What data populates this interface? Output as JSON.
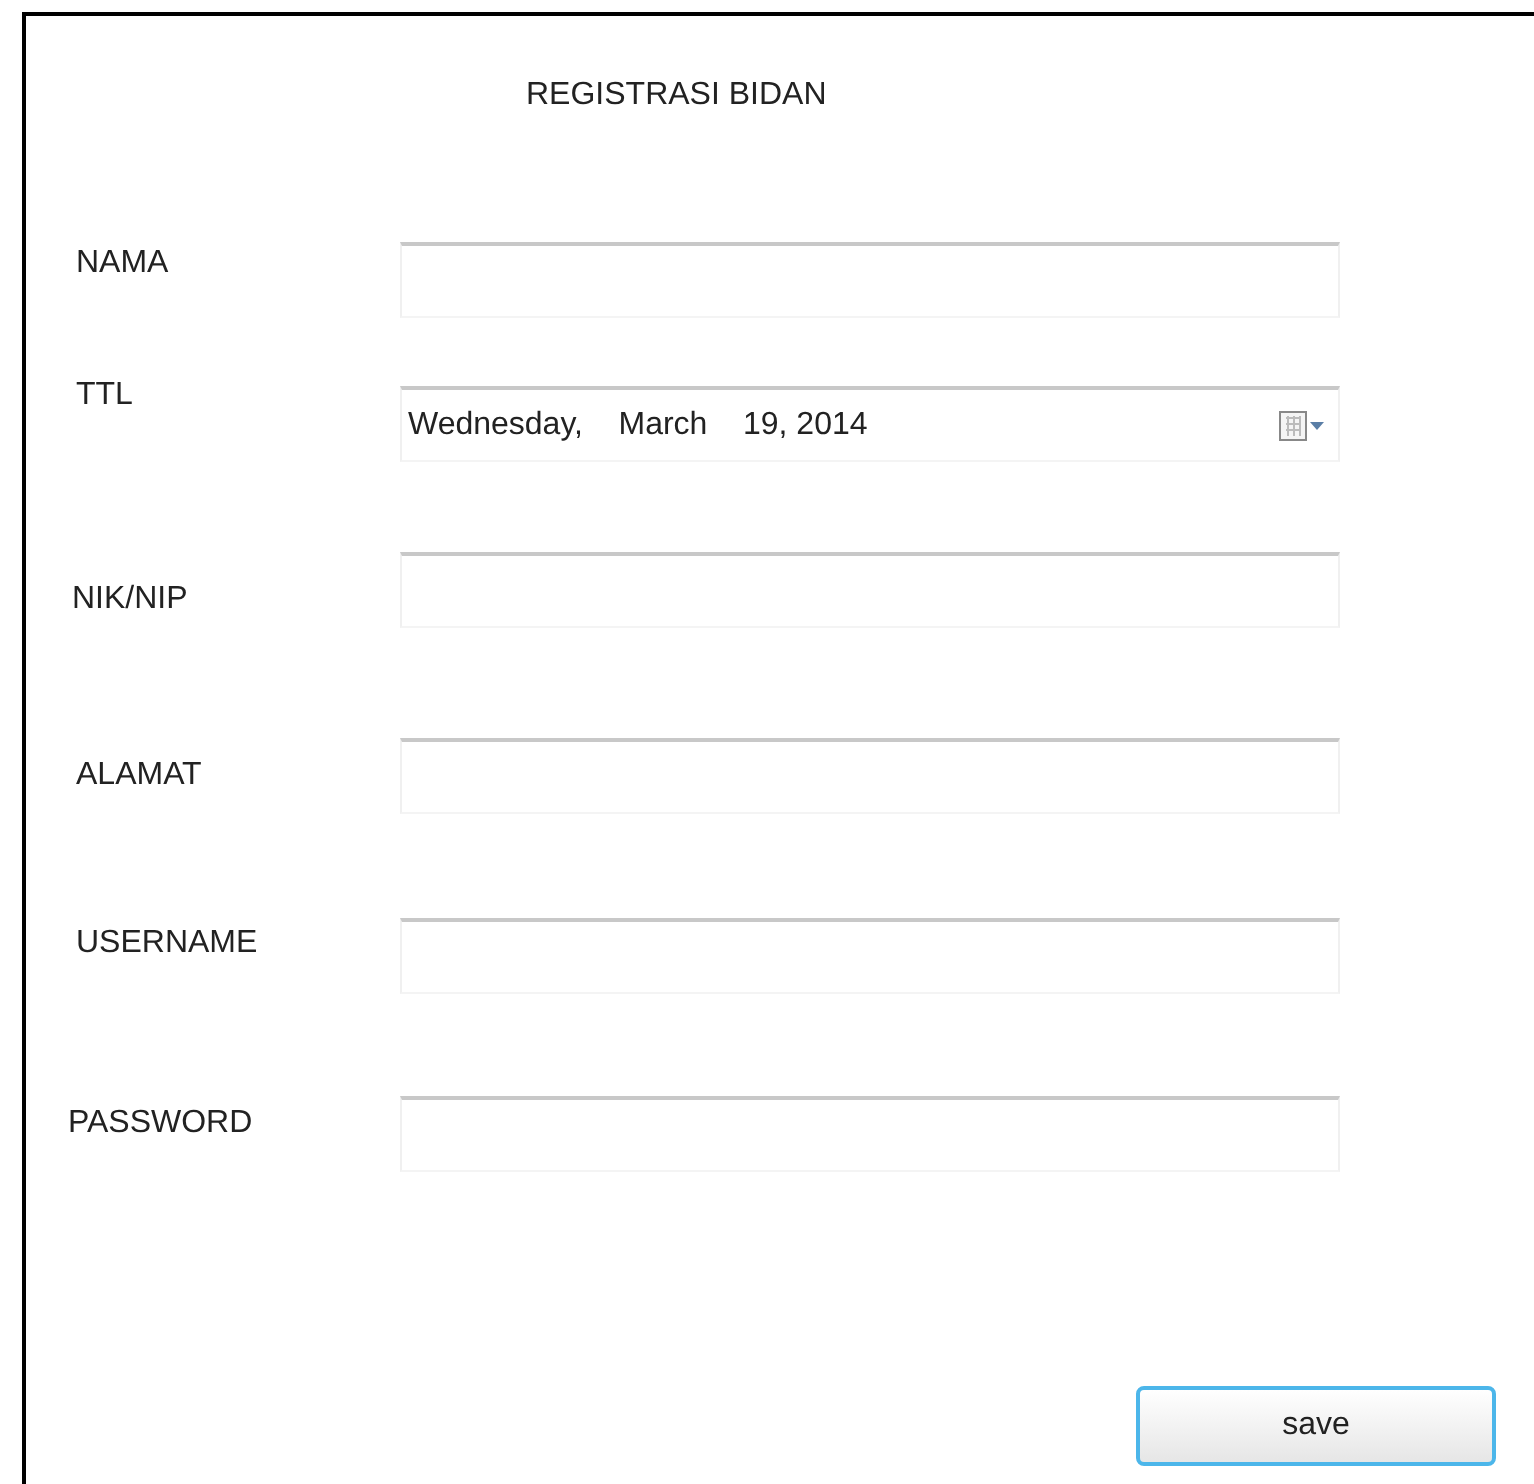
{
  "title": "REGISTRASI BIDAN",
  "fields": [
    {
      "label": "NAMA",
      "kind": "text"
    },
    {
      "label": "TTL",
      "kind": "date",
      "value": "Wednesday,    March    19, 2014"
    },
    {
      "label": "NIK/NIP",
      "kind": "text"
    },
    {
      "label": "ALAMAT",
      "kind": "text"
    },
    {
      "label": "USERNAME",
      "kind": "text"
    },
    {
      "label": "PASSWORD",
      "kind": "text"
    }
  ],
  "save_button": "save"
}
